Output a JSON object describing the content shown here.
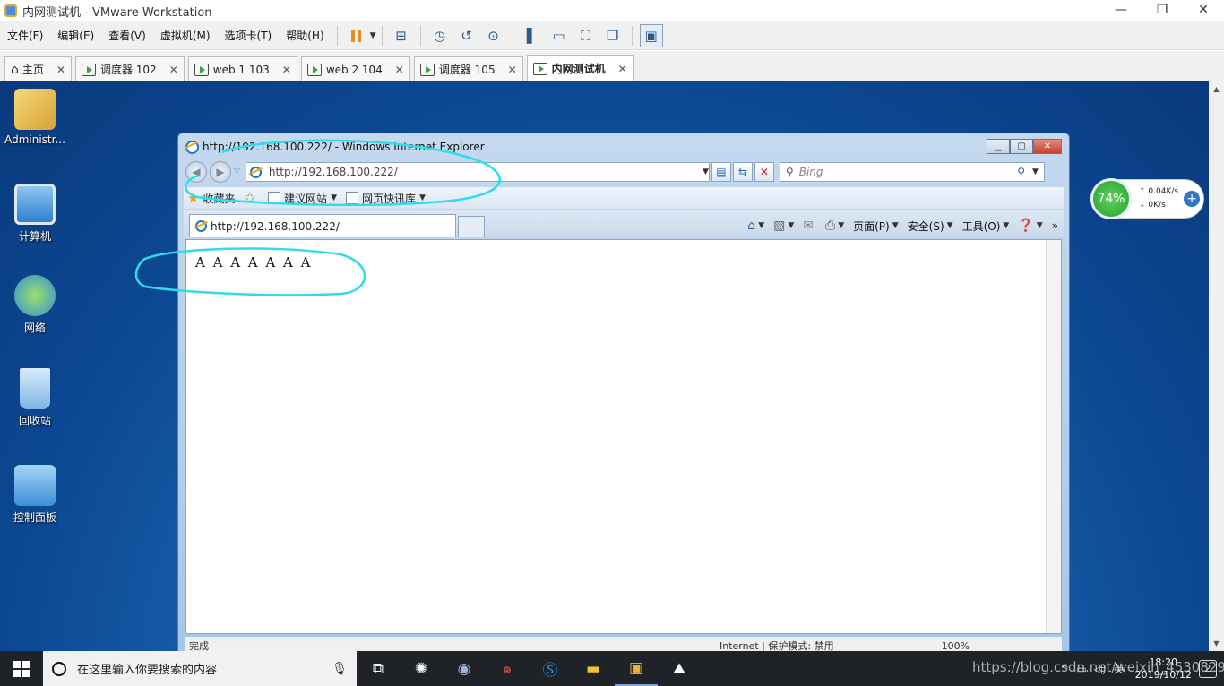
{
  "vmware": {
    "title": "内网测试机 - VMware Workstation",
    "window_controls": {
      "minimize": "—",
      "restore": "❐",
      "close": "✕"
    },
    "menu": [
      "文件(F)",
      "编辑(E)",
      "查看(V)",
      "虚拟机(M)",
      "选项卡(T)",
      "帮助(H)"
    ],
    "tabs": [
      {
        "label": "主页",
        "close": "✕"
      },
      {
        "label": "调度器 102",
        "close": "✕"
      },
      {
        "label": "web 1 103",
        "close": "✕"
      },
      {
        "label": "web 2 104",
        "close": "✕"
      },
      {
        "label": "调度器 105",
        "close": "✕"
      },
      {
        "label": "内网测试机",
        "close": "✕"
      }
    ]
  },
  "desktop": {
    "icons": [
      {
        "label": "Administr...",
        "icon": "user-folder-icon",
        "color": "#e8b84a"
      },
      {
        "label": "计算机",
        "icon": "computer-icon",
        "color": "#2d7fd0"
      },
      {
        "label": "网络",
        "icon": "network-icon",
        "color": "#3aa0d8"
      },
      {
        "label": "回收站",
        "icon": "recycle-bin-icon",
        "color": "#9ec7ea"
      },
      {
        "label": "控制面板",
        "icon": "control-panel-icon",
        "color": "#4b9fe0"
      }
    ]
  },
  "ie": {
    "title": "http://192.168.100.222/ - Windows Internet Explorer",
    "address": "http://192.168.100.222/",
    "search_placeholder": "Bing",
    "favorites": {
      "label": "收藏夹",
      "items": [
        "建议网站",
        "网页快讯库"
      ]
    },
    "tab_title": "http://192.168.100.222/",
    "commands": [
      "页面(P)",
      "安全(S)",
      "工具(O)"
    ],
    "page_body": "A A A A A A A",
    "status": {
      "left": "完成",
      "zone": "Internet | 保护模式: 禁用",
      "zoom": "100%"
    }
  },
  "net_widget": {
    "percent": "74%",
    "up": "0.04K/s",
    "down": "0K/s"
  },
  "taskbar": {
    "search_placeholder": "在这里输入你要搜索的内容",
    "ime": "英",
    "time": "18:20",
    "date": "2019/10/12",
    "notifications": "2"
  },
  "watermark": "https://blog.csdn.net/weixin_45308292",
  "colors": {
    "annotation": "#2fdcec",
    "desktop_blue": "#1d67b3"
  }
}
